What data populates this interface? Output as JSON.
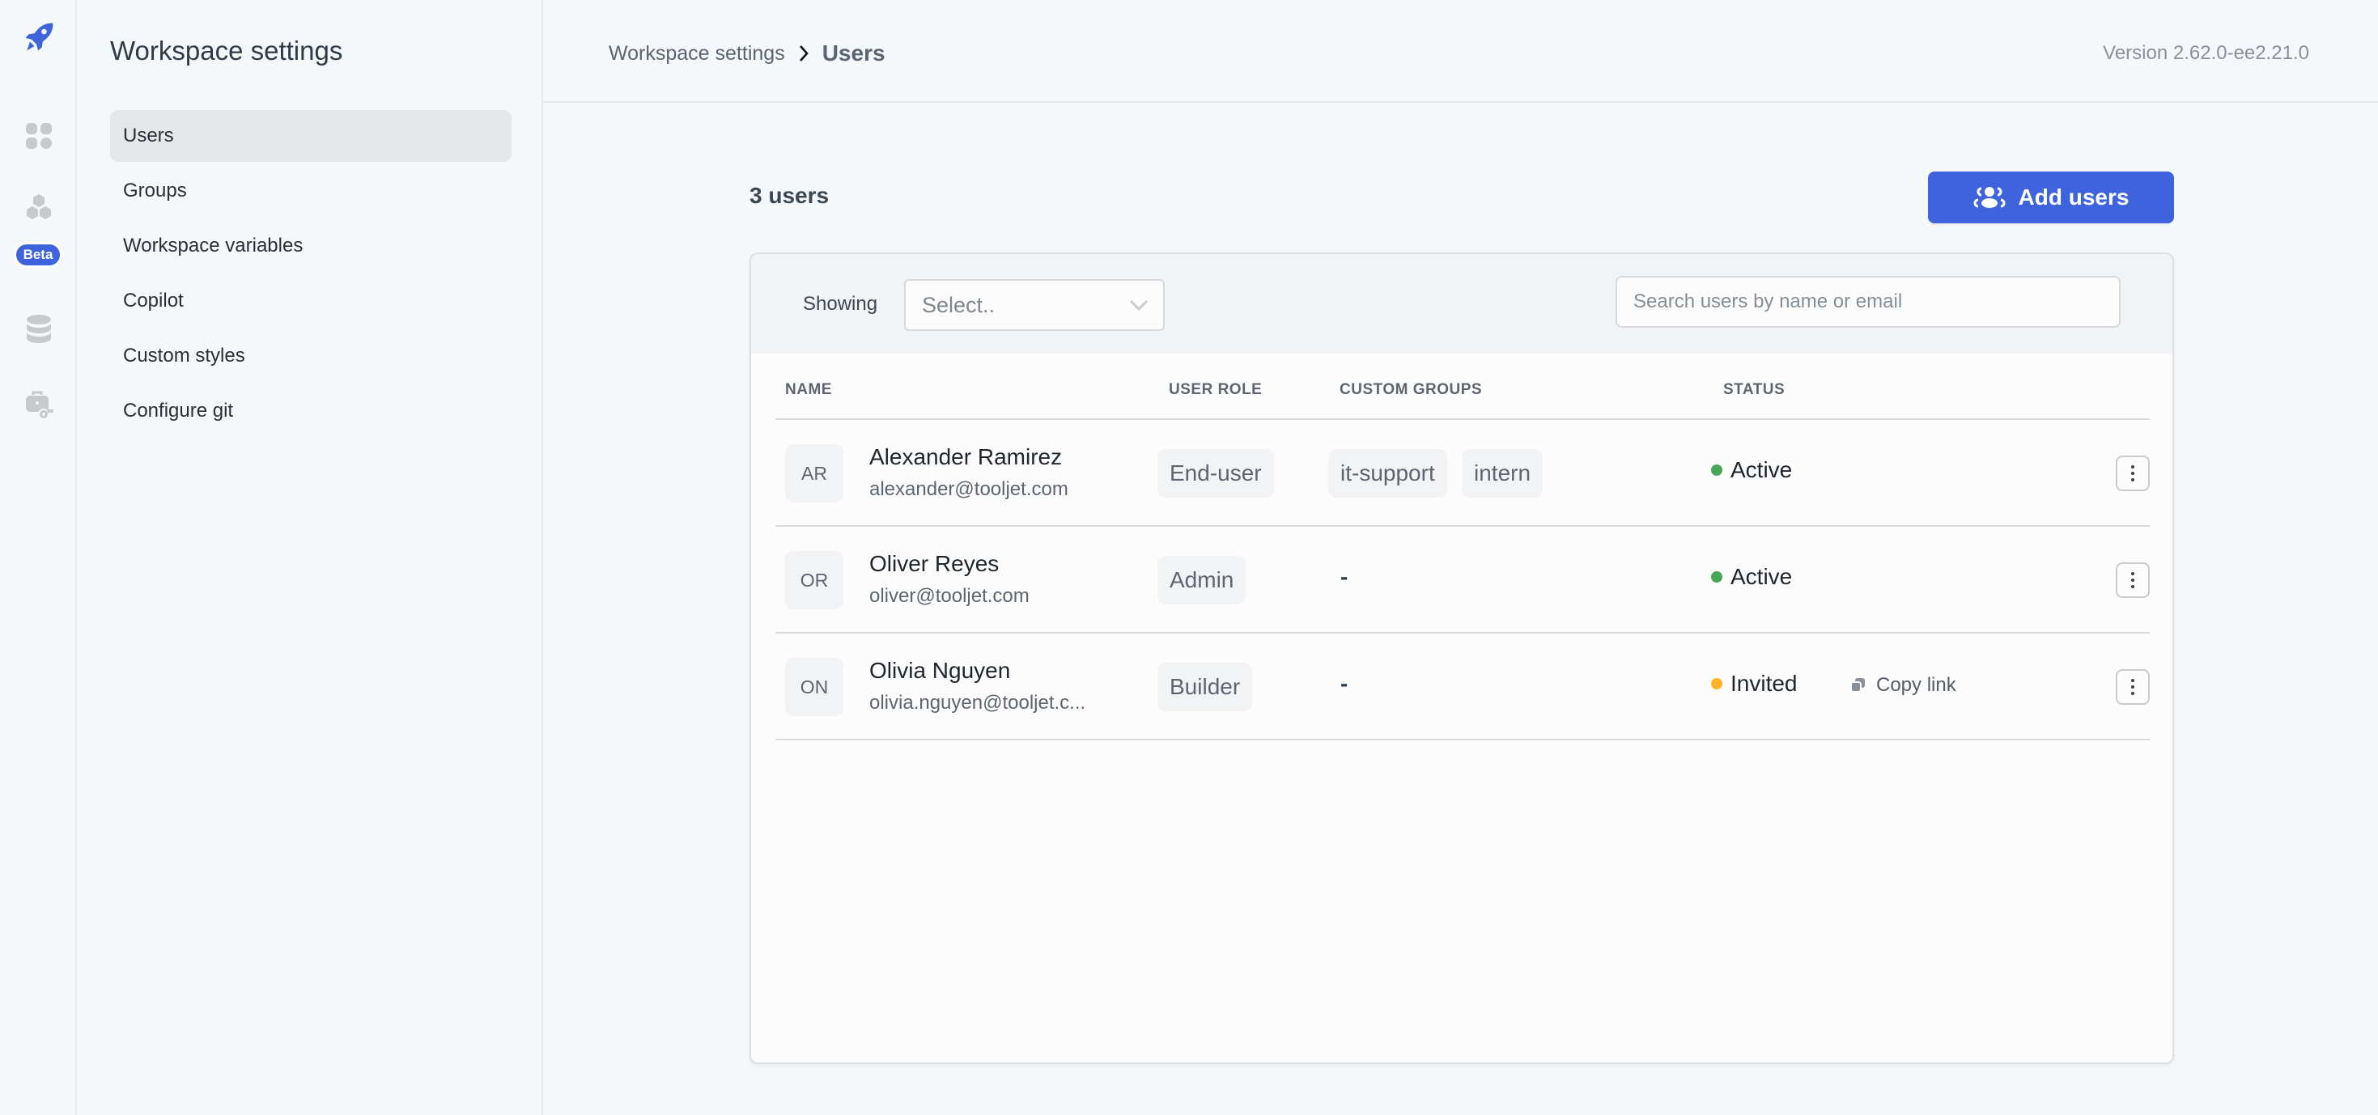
{
  "rail": {
    "items": [
      {
        "icon": "rocket-logo-icon"
      },
      {
        "icon": "apps-grid-icon"
      },
      {
        "icon": "workflows-icon",
        "badge": "Beta"
      },
      {
        "icon": "database-icon"
      },
      {
        "icon": "workspace-settings-icon"
      }
    ],
    "accent": "#3e63dd"
  },
  "sidebar": {
    "title": "Workspace settings",
    "items": [
      {
        "label": "Users",
        "active": true
      },
      {
        "label": "Groups"
      },
      {
        "label": "Workspace variables"
      },
      {
        "label": "Copilot"
      },
      {
        "label": "Custom styles"
      },
      {
        "label": "Configure git"
      }
    ]
  },
  "header": {
    "breadcrumb": [
      "Workspace settings",
      "Users"
    ],
    "version": "Version 2.62.0-ee2.21.0"
  },
  "main": {
    "count_label": "3 users",
    "add_button_label": "Add users",
    "filter": {
      "showing_label": "Showing",
      "select_placeholder": "Select..",
      "search_placeholder": "Search users by name or email",
      "search_value": ""
    },
    "columns": [
      "NAME",
      "USER ROLE",
      "CUSTOM GROUPS",
      "STATUS"
    ],
    "rows": [
      {
        "initials": "AR",
        "name": "Alexander Ramirez",
        "email": "alexander@tooljet.com",
        "role": "End-user",
        "groups": [
          "it-support",
          "intern"
        ],
        "status": "Active",
        "status_color": "#46a758"
      },
      {
        "initials": "OR",
        "name": "Oliver Reyes",
        "email": "oliver@tooljet.com",
        "role": "Admin",
        "groups": [],
        "groups_empty": "-",
        "status": "Active",
        "status_color": "#46a758"
      },
      {
        "initials": "ON",
        "name": "Olivia Nguyen",
        "email": "olivia.nguyen@tooljet.c...",
        "role": "Builder",
        "groups": [],
        "groups_empty": "-",
        "status": "Invited",
        "status_color": "#ffb224",
        "copy_link_label": "Copy link"
      }
    ]
  }
}
